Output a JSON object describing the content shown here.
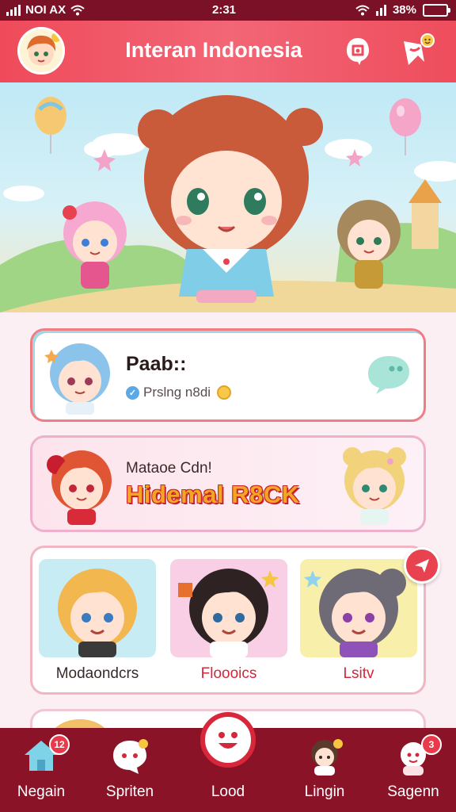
{
  "status_bar": {
    "carrier": "NOI AX",
    "time": "2:31",
    "battery": "38%"
  },
  "header": {
    "title": "Interan Indonesia",
    "avatar_icon": "user-avatar",
    "notification_icon": "bell-icon",
    "promo_icon": "gift-icon",
    "accent": "#ef4a5a"
  },
  "hero": {
    "image": "anime-characters-banner"
  },
  "profile_card": {
    "name": "Paab::",
    "subtitle": "Prslng n8di"
  },
  "event_card": {
    "top_line": "Mataoe Cdn!",
    "headline": "Hidemal R8CK"
  },
  "grid_card": {
    "tiles": [
      {
        "label": "Modaondcrs",
        "color": "#3a2a2a"
      },
      {
        "label": "Floooics",
        "color": "#d2283c"
      },
      {
        "label": "Lsitv",
        "color": "#d2283c"
      }
    ]
  },
  "bottom_nav": {
    "items": [
      {
        "label": "Negain",
        "badge": "12"
      },
      {
        "label": "Spriten",
        "badge": ""
      },
      {
        "label": "Lood",
        "badge": ""
      },
      {
        "label": "Lingin",
        "badge": ""
      },
      {
        "label": "Sagenn",
        "badge": "3"
      }
    ],
    "background": "#8a1328"
  }
}
